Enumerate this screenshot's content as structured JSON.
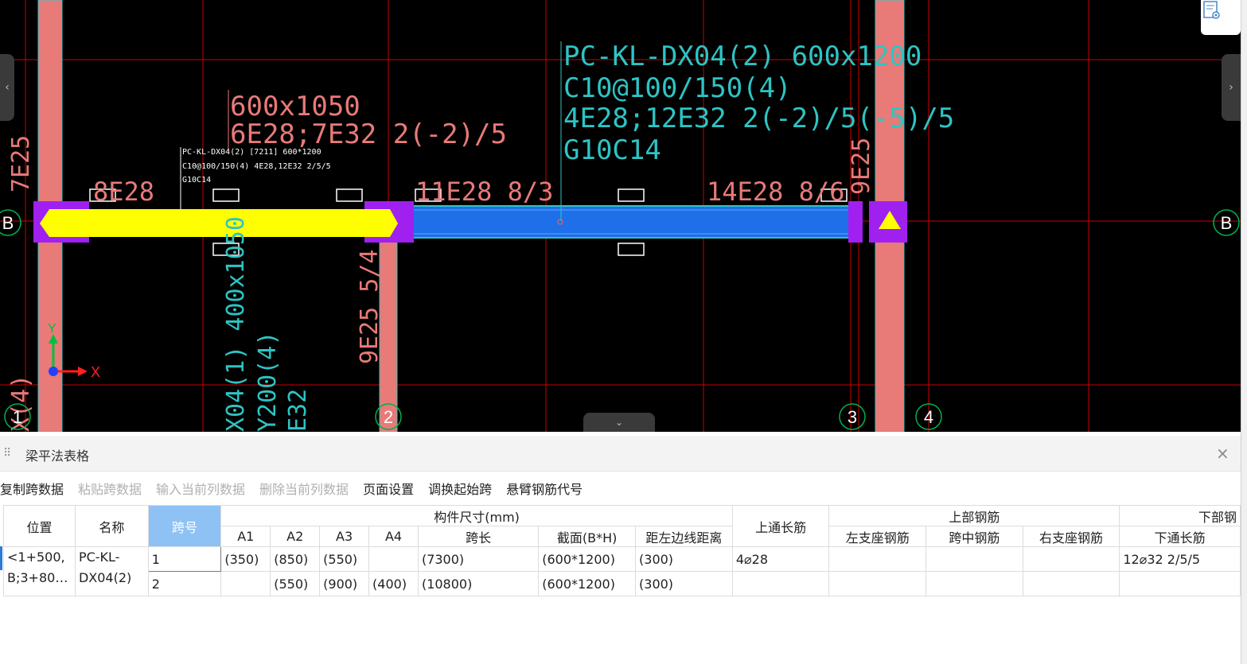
{
  "cad": {
    "beam_label_1": [
      "PC-KL-DX04(2) 600x1200",
      "C10@100/150(4)",
      "4E28;12E32 2(-2)/5(-5)/5",
      "G10C14"
    ],
    "beam_label_2": [
      "600x1050",
      "6E28;7E32 2(-2)/5"
    ],
    "small_label": [
      "PC-KL-DX04(2) [7211] 600*1200",
      "C10@100/150(4) 4E28,12E32 2/5/5",
      "G10C14"
    ],
    "top_rebar_labels": [
      "8E28",
      "11E28 8/3",
      "14E28 8/6"
    ],
    "vertical_labels": [
      "7E25",
      "9E25 5/4",
      "9E25",
      "X04(1) 400x1050",
      "Y200(4)",
      "E32",
      "X(4)"
    ],
    "axis_bubbles": [
      "B",
      "B",
      "1",
      "2",
      "3",
      "4"
    ],
    "axis_x": "X",
    "axis_y": "Y",
    "colors": {
      "beam_selected": "#ffff00",
      "beam_normal": "#1e6fe8",
      "column": "#e87a78",
      "grid_line": "#cc0000",
      "text_red": "#e87a78",
      "text_cyan": "#2ec4c4",
      "support": "#a020f0"
    }
  },
  "panel": {
    "title": "梁平法表格",
    "close": "×",
    "toolbar": [
      {
        "label": "复制跨数据",
        "enabled": true
      },
      {
        "label": "粘贴跨数据",
        "enabled": false
      },
      {
        "label": "输入当前列数据",
        "enabled": false
      },
      {
        "label": "删除当前列数据",
        "enabled": false
      },
      {
        "label": "页面设置",
        "enabled": true
      },
      {
        "label": "调换起始跨",
        "enabled": true
      },
      {
        "label": "悬臂钢筋代号",
        "enabled": true
      }
    ],
    "headers": {
      "position": "位置",
      "name": "名称",
      "span_no": "跨号",
      "dim_group": "构件尺寸(mm)",
      "a1": "A1",
      "a2": "A2",
      "a3": "A3",
      "a4": "A4",
      "span_len": "跨长",
      "section": "截面(B*H)",
      "dist_left": "距左边线距离",
      "top_through": "上通长筋",
      "top_group": "上部钢筋",
      "left_support": "左支座钢筋",
      "mid_span": "跨中钢筋",
      "right_support": "右支座钢筋",
      "bottom_group": "下部钢",
      "bottom_through": "下通长筋"
    },
    "rows": [
      {
        "position": "<1+500,",
        "name": "PC-KL-",
        "span": "1",
        "a1": "(350)",
        "a2": "(850)",
        "a3": "(550)",
        "a4": "",
        "span_len": "(7300)",
        "section": "(600*1200)",
        "dist": "(300)",
        "top_through": "4⌀28",
        "left": "",
        "mid": "",
        "right": "",
        "bottom": "12⌀32 2/5/5"
      },
      {
        "position": "B;3+80…",
        "name": "DX04(2)",
        "span": "2",
        "a1": "",
        "a2": "(550)",
        "a3": "(900)",
        "a4": "(400)",
        "span_len": "(10800)",
        "section": "(600*1200)",
        "dist": "(300)",
        "top_through": "",
        "left": "",
        "mid": "",
        "right": "",
        "bottom": ""
      }
    ]
  }
}
